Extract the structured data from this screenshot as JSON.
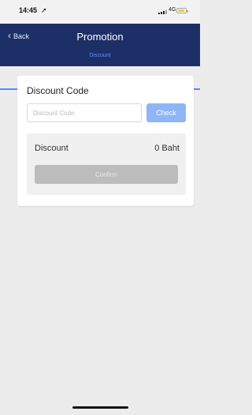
{
  "status_bar": {
    "time": "14:45",
    "location_icon": "location-arrow-icon",
    "network": "4G",
    "battery_color": "#f1cf2c"
  },
  "nav": {
    "back_label": "Back",
    "title": "Promotion",
    "subtitle": "Discount",
    "bg_color": "#1c2f66",
    "accent_color": "#5a87ff"
  },
  "form": {
    "section_label": "Discount Code",
    "code_value": "",
    "code_placeholder": "Discount Code",
    "check_label": "Check",
    "check_color": "#8fb5f7"
  },
  "summary": {
    "discount_label": "Discount",
    "discount_amount": "0 Baht",
    "confirm_label": "Confirm",
    "confirm_color": "#bcbcbc"
  }
}
